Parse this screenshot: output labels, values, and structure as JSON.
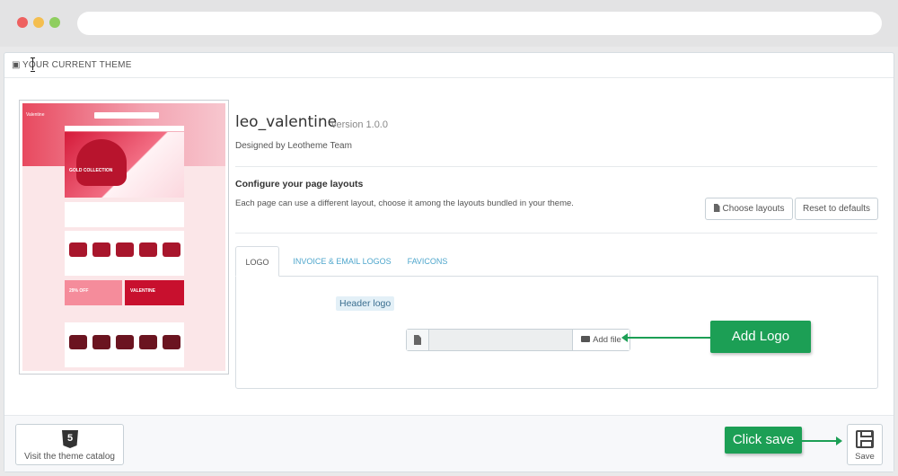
{
  "panel": {
    "title": "YOUR CURRENT THEME"
  },
  "theme": {
    "name": "leo_valentine",
    "version": "version 1.0.0",
    "author": "Designed by Leotheme Team"
  },
  "preview": {
    "logo_text": "Valentine",
    "hero_text": "GOLD COLLECTION",
    "banner_left": "29% OFF",
    "banner_right": "VALENTINE"
  },
  "layouts": {
    "title": "Configure your page layouts",
    "description": "Each page can use a different layout, choose it among the layouts bundled in your theme.",
    "choose_label": "Choose layouts",
    "reset_label": "Reset to defaults"
  },
  "tabs": [
    {
      "label": "LOGO",
      "active": true
    },
    {
      "label": "INVOICE & EMAIL LOGOS",
      "active": false
    },
    {
      "label": "FAVICONS",
      "active": false
    }
  ],
  "logo_tab": {
    "header_logo_label": "Header logo",
    "file_value": "",
    "add_file_label": "Add file"
  },
  "callouts": {
    "add_logo": "Add Logo",
    "click_save": "Click save"
  },
  "footer": {
    "catalog_label": "Visit the theme catalog",
    "catalog_icon_text": "5",
    "save_label": "Save"
  },
  "colors": {
    "accent_link": "#4ea6cc",
    "callout_green": "#1c9f55"
  }
}
